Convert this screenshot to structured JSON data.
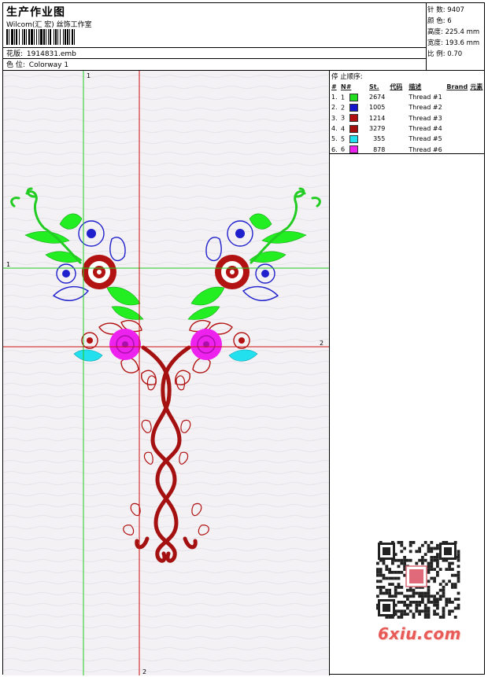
{
  "header": {
    "title": "生产作业图",
    "company": "Wilcom(汇 宏) 丝饰工作室",
    "design_label": "花版:",
    "design_file": "1914831.emb",
    "colorway_label": "色 位:",
    "colorway": "Colorway 1"
  },
  "stats": {
    "stitches_label": "针 数:",
    "stitches": "9407",
    "colors_label": "颜 色:",
    "colors": "6",
    "height_label": "高度:",
    "height": "225.4 mm",
    "width_label": "宽度:",
    "width": "193.6 mm",
    "scale_label": "比 例:",
    "scale": "0.70"
  },
  "legend": {
    "title": "停 止顺序:",
    "headers": {
      "hash": "#",
      "no": "N#",
      "st": "St.",
      "code": "代码",
      "desc": "描述",
      "brand": "Brand",
      "elem": "元素"
    },
    "rows": [
      {
        "idx": "1.",
        "n": "1",
        "color": "#22dd22",
        "st": "2674",
        "desc": "Thread #1"
      },
      {
        "idx": "2.",
        "n": "2",
        "color": "#1515cc",
        "st": "1005",
        "desc": "Thread #2"
      },
      {
        "idx": "3.",
        "n": "3",
        "color": "#b01010",
        "st": "1214",
        "desc": "Thread #3"
      },
      {
        "idx": "4.",
        "n": "4",
        "color": "#a30f0f",
        "st": "3279",
        "desc": "Thread #4"
      },
      {
        "idx": "5.",
        "n": "5",
        "color": "#22e0ee",
        "st": "355",
        "desc": "Thread #5"
      },
      {
        "idx": "6.",
        "n": "6",
        "color": "#ee22ee",
        "st": "878",
        "desc": "Thread #6"
      }
    ]
  },
  "axes": {
    "v1": "1",
    "h1": "1",
    "h2": "2",
    "v2": "2"
  },
  "watermark": {
    "site": "6xiu.com"
  }
}
